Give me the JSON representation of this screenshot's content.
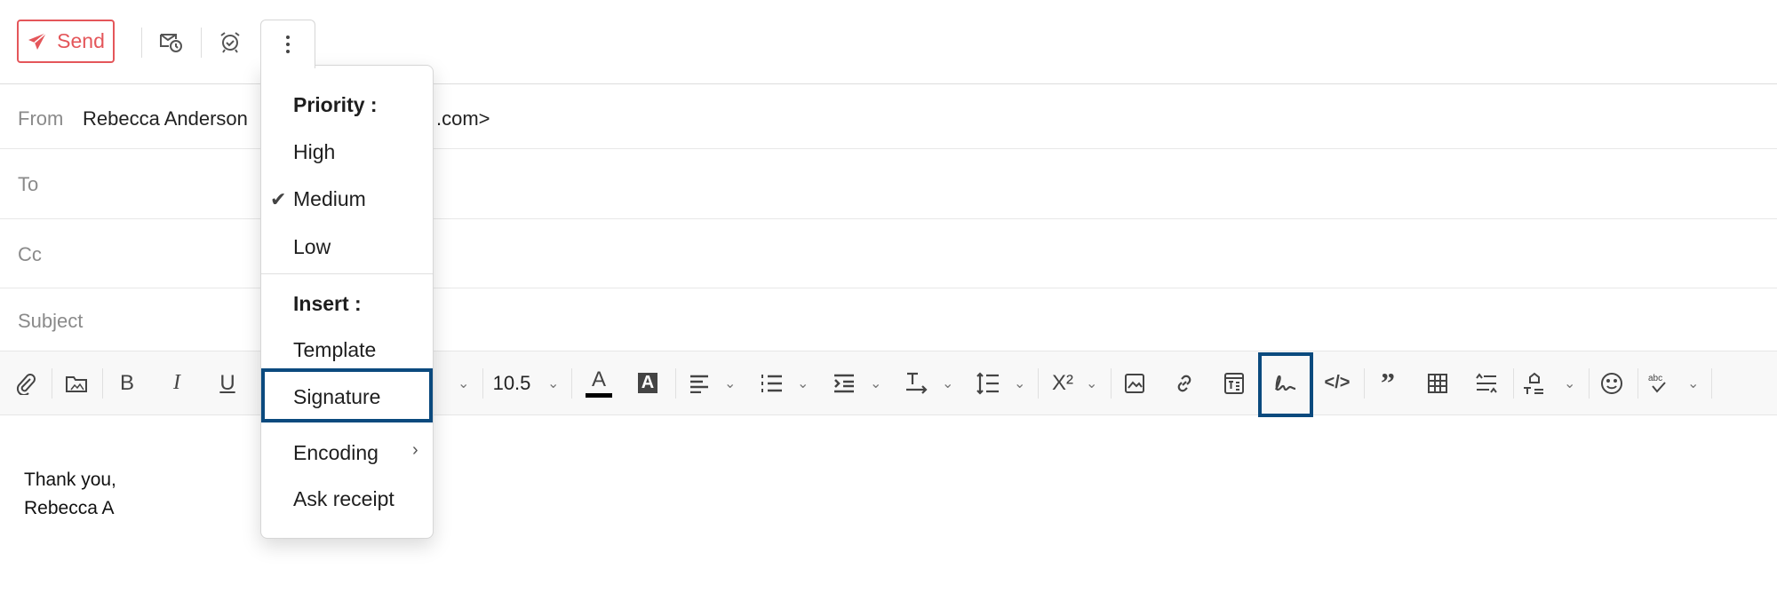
{
  "header": {
    "send_label": "Send",
    "send_color": "#e4565a",
    "icons": [
      "send-icon",
      "schedule-send-icon",
      "reminder-alarm-icon",
      "more-options-icon"
    ]
  },
  "fields": {
    "from_label": "From",
    "from_value_start": "Rebecca Anderson",
    "from_value_end": ".com>",
    "to_label": "To",
    "cc_label": "Cc",
    "subject_label": "Subject"
  },
  "toolbar": {
    "font_size": "10.5",
    "highlighted_tool": "insert-signature",
    "highlight_color": "#0b4a7e",
    "bold_label": "B",
    "italic_label": "I",
    "underline_label": "U",
    "superscript_label": "X²"
  },
  "menu": {
    "priority_heading": "Priority :",
    "priority_items": [
      {
        "label": "High",
        "checked": false
      },
      {
        "label": "Medium",
        "checked": true
      },
      {
        "label": "Low",
        "checked": false
      }
    ],
    "insert_heading": "Insert :",
    "insert_items": [
      {
        "label": "Template"
      },
      {
        "label": "Signature",
        "highlighted": true
      },
      {
        "label": "Encoding",
        "submenu": true
      },
      {
        "label": "Ask receipt"
      }
    ]
  },
  "body": {
    "lines": [
      "Thank you,",
      "Rebecca A"
    ]
  }
}
